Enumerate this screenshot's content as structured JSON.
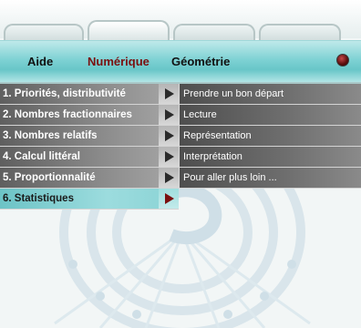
{
  "nav": {
    "items": [
      {
        "label": "Aide"
      },
      {
        "label": "Numérique"
      },
      {
        "label": "Géométrie"
      }
    ],
    "active": "Numérique",
    "active_color": "#7a1010"
  },
  "menu": {
    "items": [
      {
        "label": "1. Priorités, distributivité"
      },
      {
        "label": "2. Nombres fractionnaires"
      },
      {
        "label": "3. Nombres relatifs"
      },
      {
        "label": "4. Calcul littéral"
      },
      {
        "label": "5. Proportionnalité"
      },
      {
        "label": "6. Statistiques"
      }
    ],
    "active_index": 5,
    "active_color": "#8ad3d5"
  },
  "submenu": {
    "items": [
      {
        "label": "Prendre un bon départ"
      },
      {
        "label": "Lecture"
      },
      {
        "label": "Représentation"
      },
      {
        "label": "Interprétation"
      },
      {
        "label": "Pour aller plus loin ..."
      }
    ]
  },
  "icons": {
    "arrow": "play-arrow-icon",
    "status": "red-dot-icon"
  }
}
